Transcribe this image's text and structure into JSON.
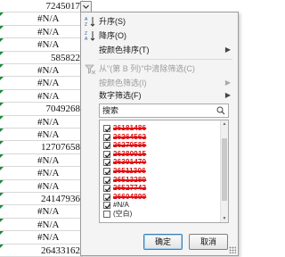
{
  "sheet": {
    "rows": [
      {
        "value": "7245017",
        "kind": "num"
      },
      {
        "value": "#N/A",
        "kind": "na"
      },
      {
        "value": "#N/A",
        "kind": "na"
      },
      {
        "value": "#N/A",
        "kind": "na"
      },
      {
        "value": "585822",
        "kind": "num"
      },
      {
        "value": "#N/A",
        "kind": "na"
      },
      {
        "value": "#N/A",
        "kind": "na"
      },
      {
        "value": "#N/A",
        "kind": "na"
      },
      {
        "value": "7049268",
        "kind": "num"
      },
      {
        "value": "#N/A",
        "kind": "na"
      },
      {
        "value": "#N/A",
        "kind": "na"
      },
      {
        "value": "12707658",
        "kind": "num"
      },
      {
        "value": "#N/A",
        "kind": "na"
      },
      {
        "value": "#N/A",
        "kind": "na"
      },
      {
        "value": "#N/A",
        "kind": "na"
      },
      {
        "value": "24147936",
        "kind": "num"
      },
      {
        "value": "#N/A",
        "kind": "na"
      },
      {
        "value": "#N/A",
        "kind": "na"
      },
      {
        "value": "#N/A",
        "kind": "na"
      },
      {
        "value": "26433162",
        "kind": "num"
      }
    ]
  },
  "menu": {
    "sort_asc": "升序(S)",
    "sort_desc": "降序(O)",
    "sort_by_color": "按颜色排序(T)",
    "clear_filter": "从\"(第 B 列)\"中清除筛选(C)",
    "filter_by_color": "按颜色筛选(I)",
    "number_filter": "数字筛选(F)",
    "search_placeholder": "搜索",
    "list_items": [
      {
        "label": "26181486",
        "checked": true,
        "redacted": true
      },
      {
        "label": "26264562",
        "checked": true,
        "redacted": true
      },
      {
        "label": "26279585",
        "checked": true,
        "redacted": true
      },
      {
        "label": "26380915",
        "checked": true,
        "redacted": true
      },
      {
        "label": "26391470",
        "checked": true,
        "redacted": true
      },
      {
        "label": "26511306",
        "checked": true,
        "redacted": true
      },
      {
        "label": "26513289",
        "checked": true,
        "redacted": true
      },
      {
        "label": "26527742",
        "checked": true,
        "redacted": true
      },
      {
        "label": "26604899",
        "checked": true,
        "redacted": true
      },
      {
        "label": "#N/A",
        "checked": true,
        "redacted": false
      },
      {
        "label": "(空白)",
        "checked": false,
        "redacted": false
      }
    ],
    "ok_label": "确定",
    "cancel_label": "取消"
  },
  "colors": {
    "accent_green": "#1e8a3a",
    "redaction_red": "#e01010",
    "ok_border": "#3c7fb1"
  }
}
